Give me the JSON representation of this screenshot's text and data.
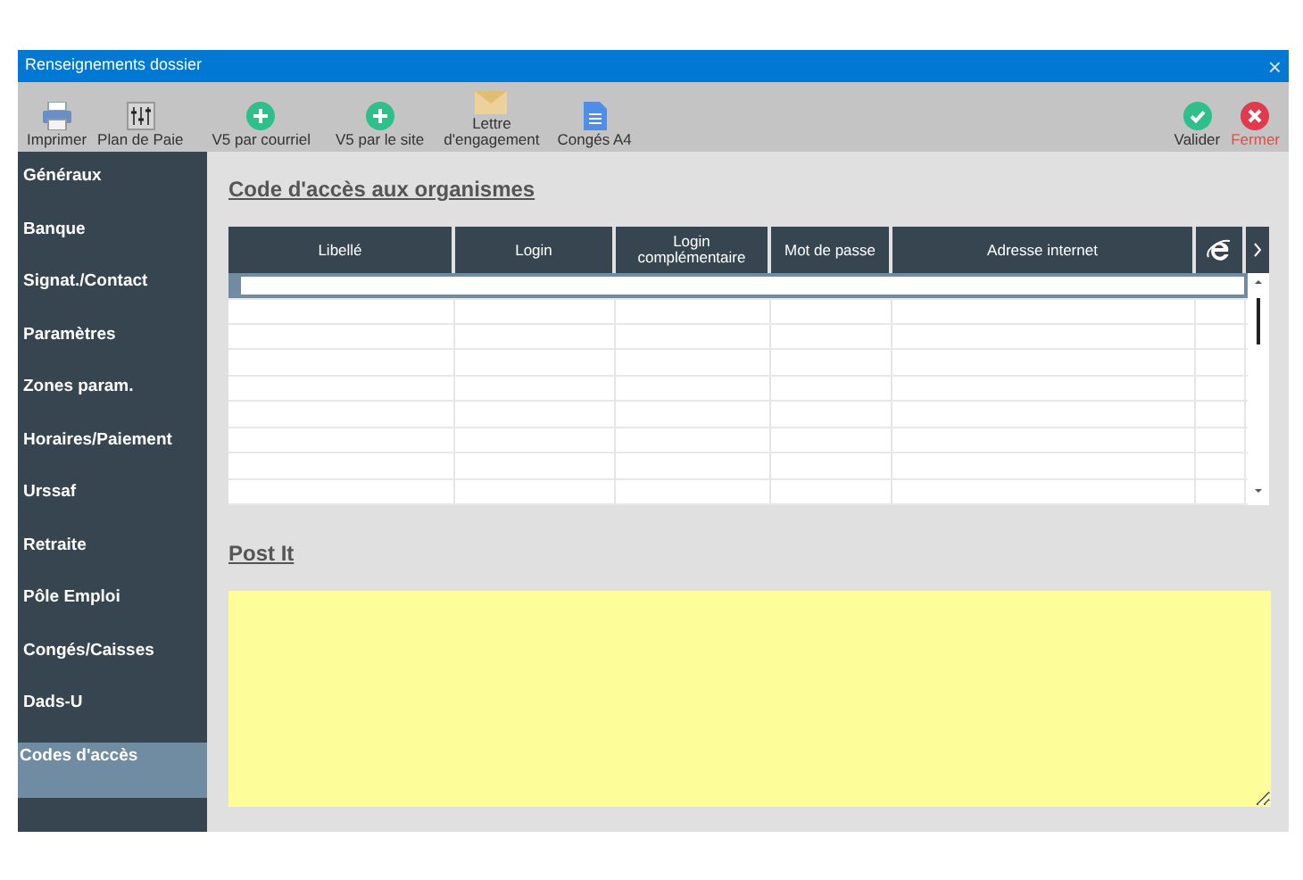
{
  "window": {
    "title": "Renseignements dossier",
    "close": "×"
  },
  "toolbar": [
    {
      "label": "Imprimer",
      "kind": "print"
    },
    {
      "label": "Plan de Paie",
      "kind": "plan"
    },
    {
      "label": "V5 par courriel",
      "kind": "add"
    },
    {
      "label": "V5 par le site",
      "kind": "add"
    },
    {
      "label": "Lettre\nd'engagement",
      "kind": "letter"
    },
    {
      "label": "Congés A4",
      "kind": "doc"
    },
    {
      "label": "Valider",
      "kind": "validate"
    },
    {
      "label": "Fermer",
      "kind": "close"
    }
  ],
  "sidebar": {
    "items": [
      {
        "label": "Généraux",
        "selected": false
      },
      {
        "label": "Banque",
        "selected": false
      },
      {
        "label": "Signat./Contact",
        "selected": false
      },
      {
        "label": "Paramètres",
        "selected": false
      },
      {
        "label": "Zones param.",
        "selected": false
      },
      {
        "label": "Horaires/Paiement",
        "selected": false
      },
      {
        "label": "Urssaf",
        "selected": false
      },
      {
        "label": "Retraite",
        "selected": false
      },
      {
        "label": "Pôle Emploi",
        "selected": false
      },
      {
        "label": "Congés/Caisses",
        "selected": false
      },
      {
        "label": "Dads-U",
        "selected": false
      },
      {
        "label": "Codes d'accès",
        "selected": true
      }
    ]
  },
  "access_codes": {
    "title": "Code d'accès aux organismes",
    "columns": [
      "Libellé",
      "Login",
      "Login\ncomplémentaire",
      "Mot de passe",
      "Adresse internet"
    ],
    "rows": [
      {
        "selected": true
      },
      {
        "selected": false
      },
      {
        "selected": false
      },
      {
        "selected": false
      },
      {
        "selected": false
      },
      {
        "selected": false
      },
      {
        "selected": false
      },
      {
        "selected": false
      },
      {
        "selected": false
      }
    ]
  },
  "post_it": {
    "title": "Post It"
  }
}
